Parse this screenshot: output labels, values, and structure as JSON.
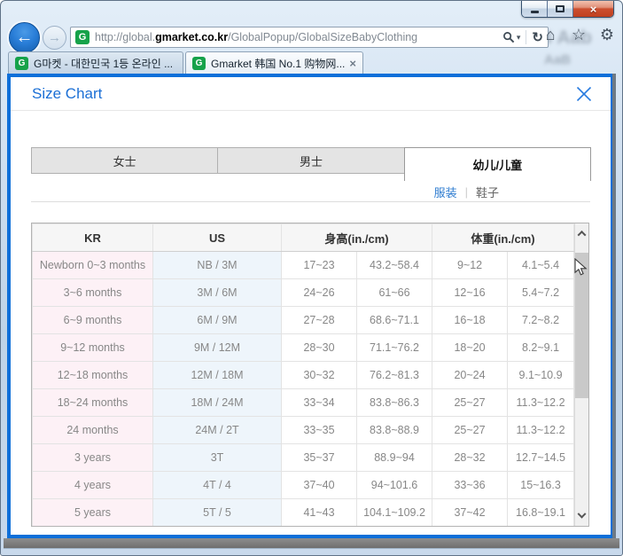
{
  "colors": {
    "accent_blue": "#0d6fd9",
    "link_blue": "#2e7cd0",
    "gmarket_green": "#16a24a",
    "kr_col_bg": "#fdf1f6",
    "us_col_bg": "#eef5fb",
    "close_red": "#c0401f"
  },
  "icons": {
    "back": "←",
    "forward": "→",
    "search": "magnifier",
    "search_caret": "▾",
    "refresh": "↻",
    "home": "⌂",
    "favorites": "☆",
    "tools": "⚙",
    "tab_close": "×",
    "favicon_letter": "G"
  },
  "decor": {
    "glass_artifact": "AaB Aab",
    "glass_artifact2": "AaB"
  },
  "browser": {
    "url": {
      "prefix": "http://global.",
      "domain": "gmarket.co.kr",
      "path": "/GlobalPopup/GlobalSizeBabyClothing"
    },
    "tabs": [
      {
        "label": "G마켓 - 대한민국 1등 온라인 ..."
      },
      {
        "label": "Gmarket 韩国 No.1 购物网...",
        "close": "×"
      }
    ]
  },
  "popup": {
    "title": "Size Chart",
    "category_tabs": [
      {
        "label": "女士"
      },
      {
        "label": "男士"
      },
      {
        "label": "幼儿/儿童"
      }
    ],
    "subtabs": [
      {
        "label": "服装"
      },
      {
        "label": "鞋子"
      }
    ],
    "subtab_separator": "|",
    "table": {
      "headers": [
        "KR",
        "US",
        "身高(in./cm)",
        "体重(in./cm)"
      ],
      "rows": [
        [
          "Newborn 0~3 months",
          "NB / 3M",
          "17~23",
          "43.2~58.4",
          "9~12",
          "4.1~5.4"
        ],
        [
          "3~6 months",
          "3M / 6M",
          "24~26",
          "61~66",
          "12~16",
          "5.4~7.2"
        ],
        [
          "6~9 months",
          "6M / 9M",
          "27~28",
          "68.6~71.1",
          "16~18",
          "7.2~8.2"
        ],
        [
          "9~12 months",
          "9M / 12M",
          "28~30",
          "71.1~76.2",
          "18~20",
          "8.2~9.1"
        ],
        [
          "12~18 months",
          "12M / 18M",
          "30~32",
          "76.2~81.3",
          "20~24",
          "9.1~10.9"
        ],
        [
          "18~24 months",
          "18M / 24M",
          "33~34",
          "83.8~86.3",
          "25~27",
          "11.3~12.2"
        ],
        [
          "24 months",
          "24M / 2T",
          "33~35",
          "83.8~88.9",
          "25~27",
          "11.3~12.2"
        ],
        [
          "3 years",
          "3T",
          "35~37",
          "88.9~94",
          "28~32",
          "12.7~14.5"
        ],
        [
          "4 years",
          "4T / 4",
          "37~40",
          "94~101.6",
          "33~36",
          "15~16.3"
        ],
        [
          "5 years",
          "5T / 5",
          "41~43",
          "104.1~109.2",
          "37~42",
          "16.8~19.1"
        ]
      ]
    }
  }
}
